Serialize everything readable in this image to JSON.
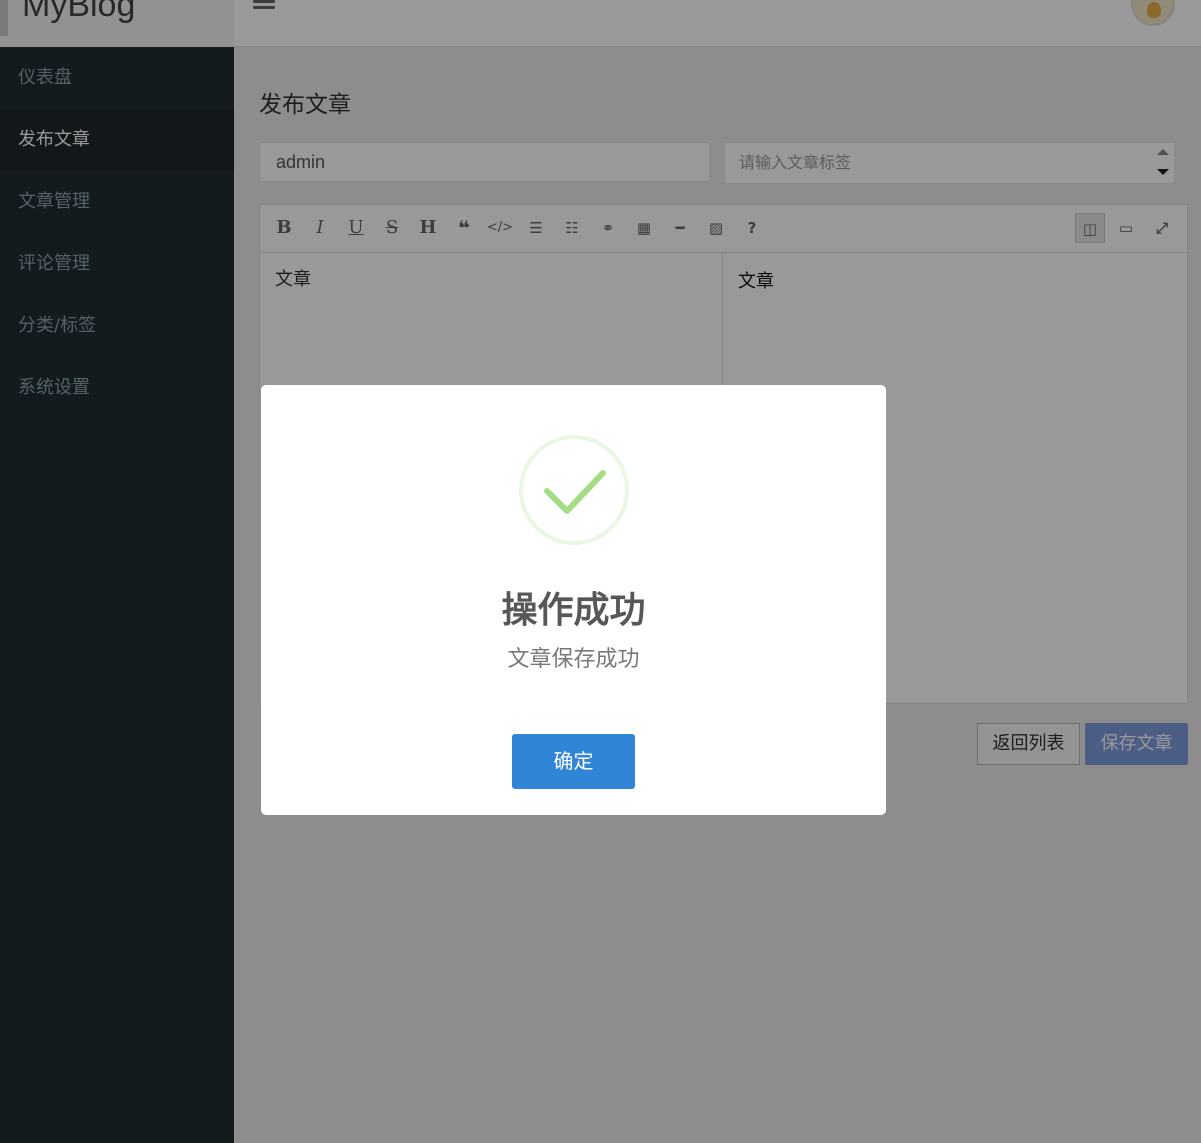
{
  "app": {
    "brand": "MyBlog"
  },
  "sidebar": {
    "items": [
      {
        "label": "仪表盘"
      },
      {
        "label": "发布文章"
      },
      {
        "label": "文章管理"
      },
      {
        "label": "评论管理"
      },
      {
        "label": "分类/标签"
      },
      {
        "label": "系统设置"
      }
    ],
    "active_index": 1
  },
  "main": {
    "title": "发布文章",
    "name_field_value": "admin",
    "tags_placeholder": "请输入文章标签",
    "editor": {
      "toolbar": [
        "bold-icon",
        "italic-icon",
        "underline-icon",
        "strikethrough-icon",
        "heading-icon",
        "quote-icon",
        "code-icon",
        "ordered-list-icon",
        "unordered-list-icon",
        "link-icon",
        "table-icon",
        "horizontal-rule-icon",
        "image-icon",
        "help-icon",
        "side-by-side-icon",
        "preview-icon",
        "fullscreen-icon"
      ],
      "source_text": "文章",
      "preview_text": "文章"
    },
    "back_button": "返回列表",
    "save_button": "保存文章"
  },
  "dialog": {
    "title": "操作成功",
    "text": "文章保存成功",
    "confirm": "确定",
    "icon": "success-check-icon"
  },
  "colors": {
    "sidebar_bg": "#222d32",
    "confirm_button": "#3085d6",
    "success_check": "#a5dc86"
  }
}
